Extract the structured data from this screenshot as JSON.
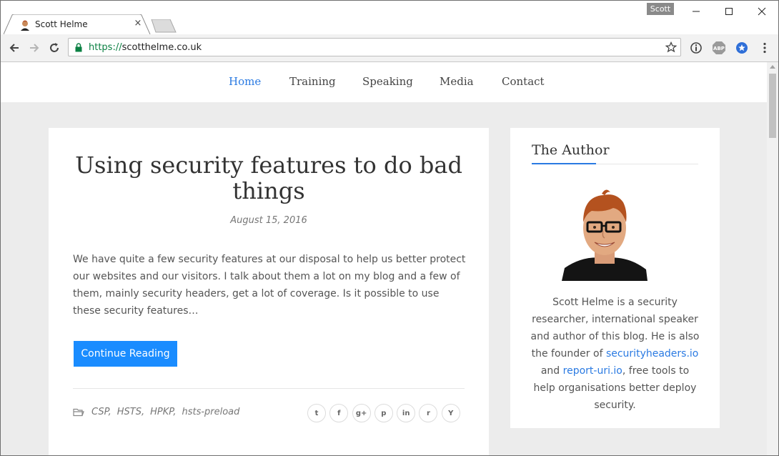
{
  "browser": {
    "tab_title": "Scott Helme",
    "tab_close": "×",
    "profile_name": "Scott",
    "url_scheme": "https://",
    "url_host": "scotthelme.co.uk",
    "extensions": [
      "info-icon",
      "adblock-icon",
      "star-badge-icon",
      "more-menu-icon"
    ],
    "adblock_label": "ABP"
  },
  "site": {
    "nav": [
      {
        "label": "Home",
        "active": true
      },
      {
        "label": "Training"
      },
      {
        "label": "Speaking"
      },
      {
        "label": "Media"
      },
      {
        "label": "Contact"
      }
    ]
  },
  "post": {
    "title": "Using security features to do bad things",
    "date": "August 15, 2016",
    "excerpt": "We have quite a few security features at our disposal to help us better protect our websites and our visitors. I talk about them a lot on my blog and a few of them, mainly security headers, get a lot of coverage. Is it possible to use these security features…",
    "read_more": "Continue Reading",
    "tags": [
      "CSP,",
      "HSTS,",
      "HPKP,",
      "hsts-preload"
    ],
    "share_icons": [
      "twitter-icon",
      "facebook-icon",
      "google-plus-icon",
      "pinterest-icon",
      "linkedin-icon",
      "reddit-icon",
      "hacker-news-icon"
    ],
    "share_labels": [
      "t",
      "f",
      "g+",
      "p",
      "in",
      "r",
      "Y"
    ]
  },
  "sidebar": {
    "widget_title": "The Author",
    "bio_part1": "Scott Helme is a security researcher, international speaker and author of this blog. He is also the founder of ",
    "bio_link1": "securityheaders.io",
    "bio_part2": " and ",
    "bio_link2": "report-uri.io",
    "bio_part3": ", free tools to help organisations better deploy security."
  },
  "colors": {
    "accent": "#2a7ae2",
    "button": "#1a8cff",
    "page_bg": "#ececec"
  }
}
